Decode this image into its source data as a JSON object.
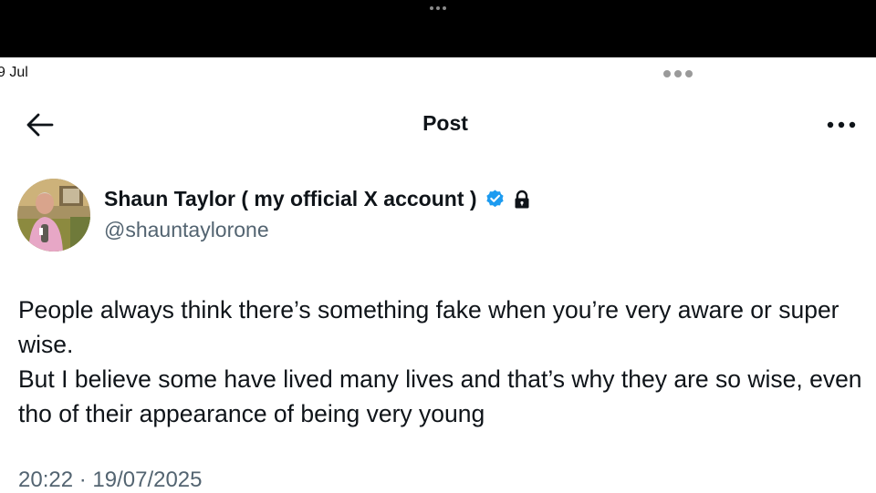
{
  "date_tab": "9 Jul",
  "header": {
    "title": "Post"
  },
  "author": {
    "display_name": "Shaun Taylor ( my official X account )",
    "handle": "@shauntaylorone",
    "verified": true,
    "protected": true
  },
  "post": {
    "lines": [
      "People always think there’s something fake when you’re very aware or super wise.",
      "But I believe some have lived many lives and that’s why they are so wise, even tho of their appearance of being very young"
    ],
    "timestamp": "20:22 · 19/07/2025"
  },
  "icons": {
    "back": "arrow-left-icon",
    "more": "more-horizontal-icon",
    "verified": "verified-badge-icon",
    "lock": "lock-icon"
  },
  "colors": {
    "verified_blue": "#1d9bf0",
    "secondary_text": "#536471",
    "primary_text": "#0f1419",
    "top_bar": "#000000"
  }
}
